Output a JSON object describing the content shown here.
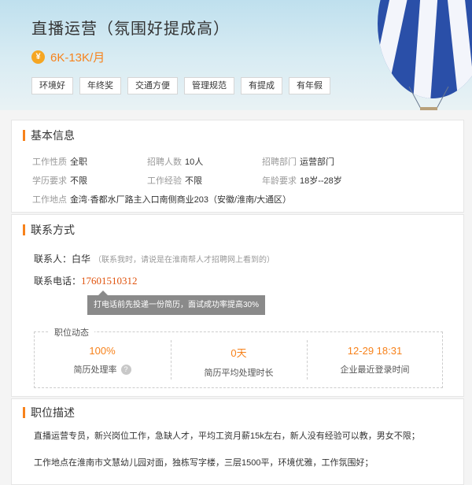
{
  "job": {
    "title": "直播运营（氛围好提成高）",
    "salary": "6K-13K/月",
    "currency_symbol": "¥",
    "tags": [
      "环境好",
      "年终奖",
      "交通方便",
      "管理规范",
      "有提成",
      "有年假"
    ]
  },
  "basic": {
    "section_title": "基本信息",
    "nature_label": "工作性质",
    "nature_value": "全职",
    "headcount_label": "招聘人数",
    "headcount_value": "10人",
    "dept_label": "招聘部门",
    "dept_value": "运营部门",
    "edu_label": "学历要求",
    "edu_value": "不限",
    "exp_label": "工作经验",
    "exp_value": "不限",
    "age_label": "年龄要求",
    "age_value": "18岁--28岁",
    "addr_label": "工作地点",
    "addr_value": "金湾·香都水厂路主入口南侧商业203（安徽/淮南/大通区）"
  },
  "contact": {
    "section_title": "联系方式",
    "person_label": "联系人：",
    "person_name": "白华",
    "person_hint": "（联系我时，请说是在淮南帮人才招聘网上看到的）",
    "phone_label": "联系电话：",
    "phone": "17601510312",
    "tooltip": "打电话前先投递一份简历，面试成功率提高30%"
  },
  "dynamics": {
    "title": "职位动态",
    "items": [
      {
        "value": "100%",
        "label": "简历处理率",
        "help": "?"
      },
      {
        "value": "0天",
        "label": "简历平均处理时长"
      },
      {
        "value": "12-29 18:31",
        "label": "企业最近登录时间"
      }
    ]
  },
  "description": {
    "section_title": "职位描述",
    "line1": "直播运营专员，新兴岗位工作，急缺人才，平均工资月薪15k左右，新人没有经验可以教，男女不限；",
    "line2": "工作地点在淮南市文慧幼儿园对面，独栋写字楼，三层1500平，环境优雅，工作氛围好；"
  },
  "colors": {
    "accent": "#f7821b",
    "phone": "#e0530d"
  }
}
